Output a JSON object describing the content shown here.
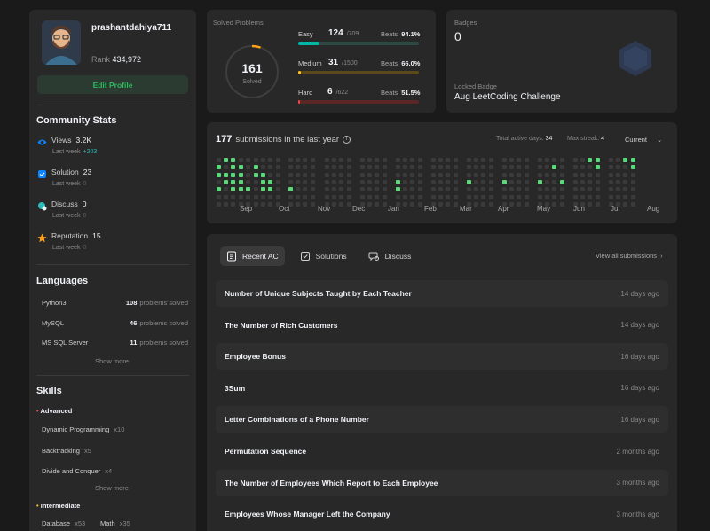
{
  "profile": {
    "username": "prashantdahiya711",
    "rank_label": "Rank",
    "rank_value": "434,972",
    "edit_button": "Edit Profile"
  },
  "community": {
    "title": "Community Stats",
    "items": [
      {
        "label": "Views",
        "value": "3.2K",
        "sub_label": "Last week",
        "sub_value": "+203",
        "icon": "eye-icon",
        "color": "#0a84ff"
      },
      {
        "label": "Solution",
        "value": "23",
        "sub_label": "Last week",
        "sub_value": "0",
        "icon": "solution-icon",
        "color": "#0a84ff"
      },
      {
        "label": "Discuss",
        "value": "0",
        "sub_label": "Last week",
        "sub_value": "0",
        "icon": "discuss-icon",
        "color": "#2cbbb6"
      },
      {
        "label": "Reputation",
        "value": "15",
        "sub_label": "Last week",
        "sub_value": "0",
        "icon": "star-icon",
        "color": "#ffa116"
      }
    ]
  },
  "languages": {
    "title": "Languages",
    "items": [
      {
        "name": "Python3",
        "count": "108",
        "suffix": "problems solved"
      },
      {
        "name": "MySQL",
        "count": "46",
        "suffix": "problems solved"
      },
      {
        "name": "MS SQL Server",
        "count": "11",
        "suffix": "problems solved"
      }
    ],
    "show_more": "Show more"
  },
  "skills": {
    "title": "Skills",
    "advanced_label": "Advanced",
    "advanced": [
      {
        "name": "Dynamic Programming",
        "count": "x10"
      },
      {
        "name": "Backtracking",
        "count": "x5"
      },
      {
        "name": "Divide and Conquer",
        "count": "x4"
      }
    ],
    "show_more": "Show more",
    "intermediate_label": "Intermediate",
    "intermediate": [
      {
        "name": "Database",
        "count": "x53"
      },
      {
        "name": "Math",
        "count": "x35"
      }
    ]
  },
  "solved": {
    "title": "Solved Problems",
    "total": "161",
    "total_label": "Solved",
    "progress_fraction": 0.0535,
    "rows": [
      {
        "level": "Easy",
        "solved": "124",
        "total": "/709",
        "beats_label": "Beats",
        "beats": "94.1%",
        "fraction": 0.175,
        "color": "#00b8a3",
        "track": "#2a4a44"
      },
      {
        "level": "Medium",
        "solved": "31",
        "total": "/1500",
        "beats_label": "Beats",
        "beats": "66.0%",
        "fraction": 0.021,
        "color": "#ffc01e",
        "track": "#5a4a1a"
      },
      {
        "level": "Hard",
        "solved": "6",
        "total": "/622",
        "beats_label": "Beats",
        "beats": "51.5%",
        "fraction": 0.01,
        "color": "#ef4743",
        "track": "#5a2626"
      }
    ]
  },
  "badges": {
    "title": "Badges",
    "count": "0",
    "locked_label": "Locked Badge",
    "locked_name": "Aug LeetCoding Challenge"
  },
  "calendar": {
    "count": "177",
    "label": "submissions in the last year",
    "active_label": "Total active days:",
    "active_value": "34",
    "streak_label": "Max streak:",
    "streak_value": "4",
    "period": "Current",
    "months": [
      "Sep",
      "Oct",
      "Nov",
      "Dec",
      "Jan",
      "Feb",
      "Mar",
      "Apr",
      "May",
      "Jun",
      "Jul",
      "Aug"
    ],
    "active_cells": [
      [
        0,
        1
      ],
      [
        0,
        2
      ],
      [
        0,
        4
      ],
      [
        1,
        0
      ],
      [
        1,
        2
      ],
      [
        1,
        3
      ],
      [
        2,
        0
      ],
      [
        2,
        1
      ],
      [
        2,
        2
      ],
      [
        2,
        3
      ],
      [
        2,
        4
      ],
      [
        3,
        1
      ],
      [
        3,
        2
      ],
      [
        3,
        3
      ],
      [
        3,
        4
      ],
      [
        4,
        4
      ],
      [
        5,
        1
      ],
      [
        5,
        2
      ],
      [
        6,
        2
      ],
      [
        6,
        3
      ],
      [
        6,
        4
      ],
      [
        7,
        3
      ],
      [
        7,
        4
      ],
      [
        9,
        4
      ],
      [
        21,
        3
      ],
      [
        21,
        4
      ],
      [
        29,
        3
      ],
      [
        33,
        3
      ],
      [
        37,
        3
      ],
      [
        39,
        1
      ],
      [
        40,
        3
      ],
      [
        43,
        0
      ],
      [
        44,
        0
      ],
      [
        44,
        1
      ],
      [
        47,
        0
      ],
      [
        48,
        0
      ],
      [
        48,
        1
      ],
      [
        49,
        1
      ],
      [
        52,
        2
      ],
      [
        53,
        0
      ],
      [
        53,
        1
      ],
      [
        57,
        2
      ]
    ]
  },
  "recent": {
    "tabs": [
      {
        "label": "Recent AC",
        "icon": "list-icon"
      },
      {
        "label": "Solutions",
        "icon": "solution-icon"
      },
      {
        "label": "Discuss",
        "icon": "discuss-icon"
      }
    ],
    "view_all": "View all submissions",
    "items": [
      {
        "title": "Number of Unique Subjects Taught by Each Teacher",
        "time": "14 days ago"
      },
      {
        "title": "The Number of Rich Customers",
        "time": "14 days ago"
      },
      {
        "title": "Employee Bonus",
        "time": "16 days ago"
      },
      {
        "title": "3Sum",
        "time": "16 days ago"
      },
      {
        "title": "Letter Combinations of a Phone Number",
        "time": "16 days ago"
      },
      {
        "title": "Permutation Sequence",
        "time": "2 months ago"
      },
      {
        "title": "The Number of Employees Which Report to Each Employee",
        "time": "3 months ago"
      },
      {
        "title": "Employees Whose Manager Left the Company",
        "time": "3 months ago"
      }
    ]
  }
}
